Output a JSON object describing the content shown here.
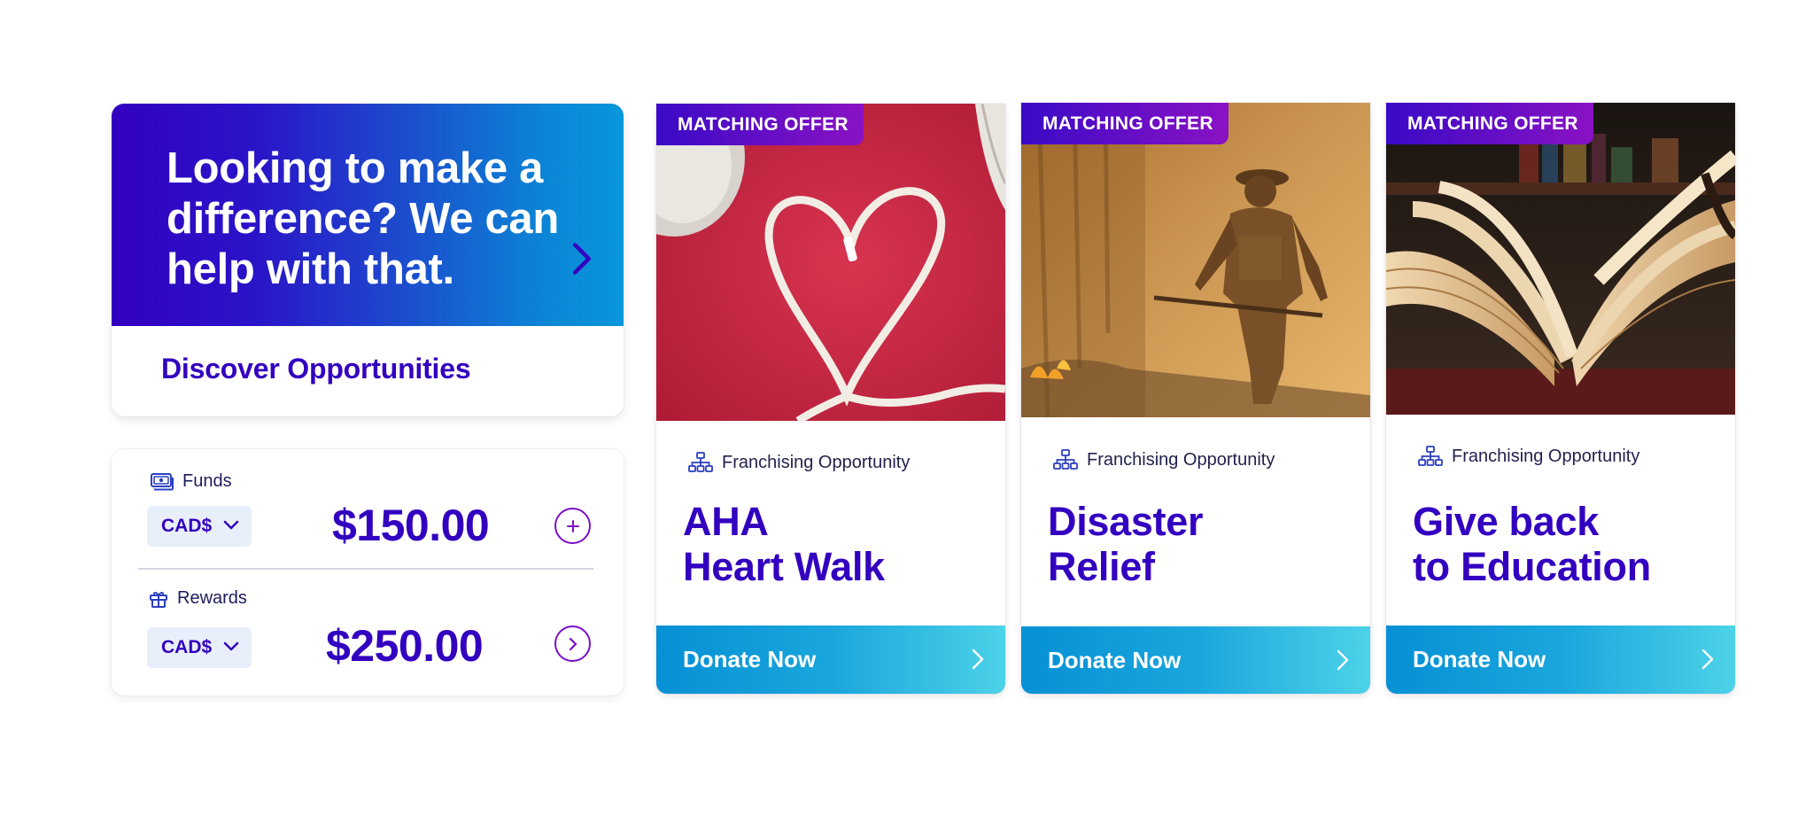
{
  "hero": {
    "heading": "Looking to make a difference? We can help with that.",
    "link": "Discover Opportunities",
    "colors": {
      "gradient_start": "#3300c0",
      "gradient_end": "#0896dc"
    }
  },
  "wallet": {
    "funds": {
      "label": "Funds",
      "currency": "CAD$",
      "amount": "$150.00",
      "action_icon": "plus-icon"
    },
    "rewards": {
      "label": "Rewards",
      "currency": "CAD$",
      "amount": "$250.00",
      "action_icon": "chevron-right-icon"
    }
  },
  "opportunities": [
    {
      "badge": "MATCHING OFFER",
      "category": "Franchising Opportunity",
      "title_line1": "AHA",
      "title_line2": "Heart Walk",
      "cta": "Donate Now",
      "image": "shoelace heart on red"
    },
    {
      "badge": "MATCHING OFFER",
      "category": "Franchising Opportunity",
      "title_line1": "Disaster",
      "title_line2": "Relief",
      "cta": "Donate Now",
      "image": "firefighter in smoke"
    },
    {
      "badge": "MATCHING OFFER",
      "category": "Franchising Opportunity",
      "title_line1": "Give back",
      "title_line2": "to Education",
      "cta": "Donate Now",
      "image": "open book"
    }
  ],
  "colors": {
    "primary": "#3300c0",
    "badge_end": "#8a12c4",
    "donate_start": "#0690d6",
    "donate_end": "#4cd2e8"
  }
}
